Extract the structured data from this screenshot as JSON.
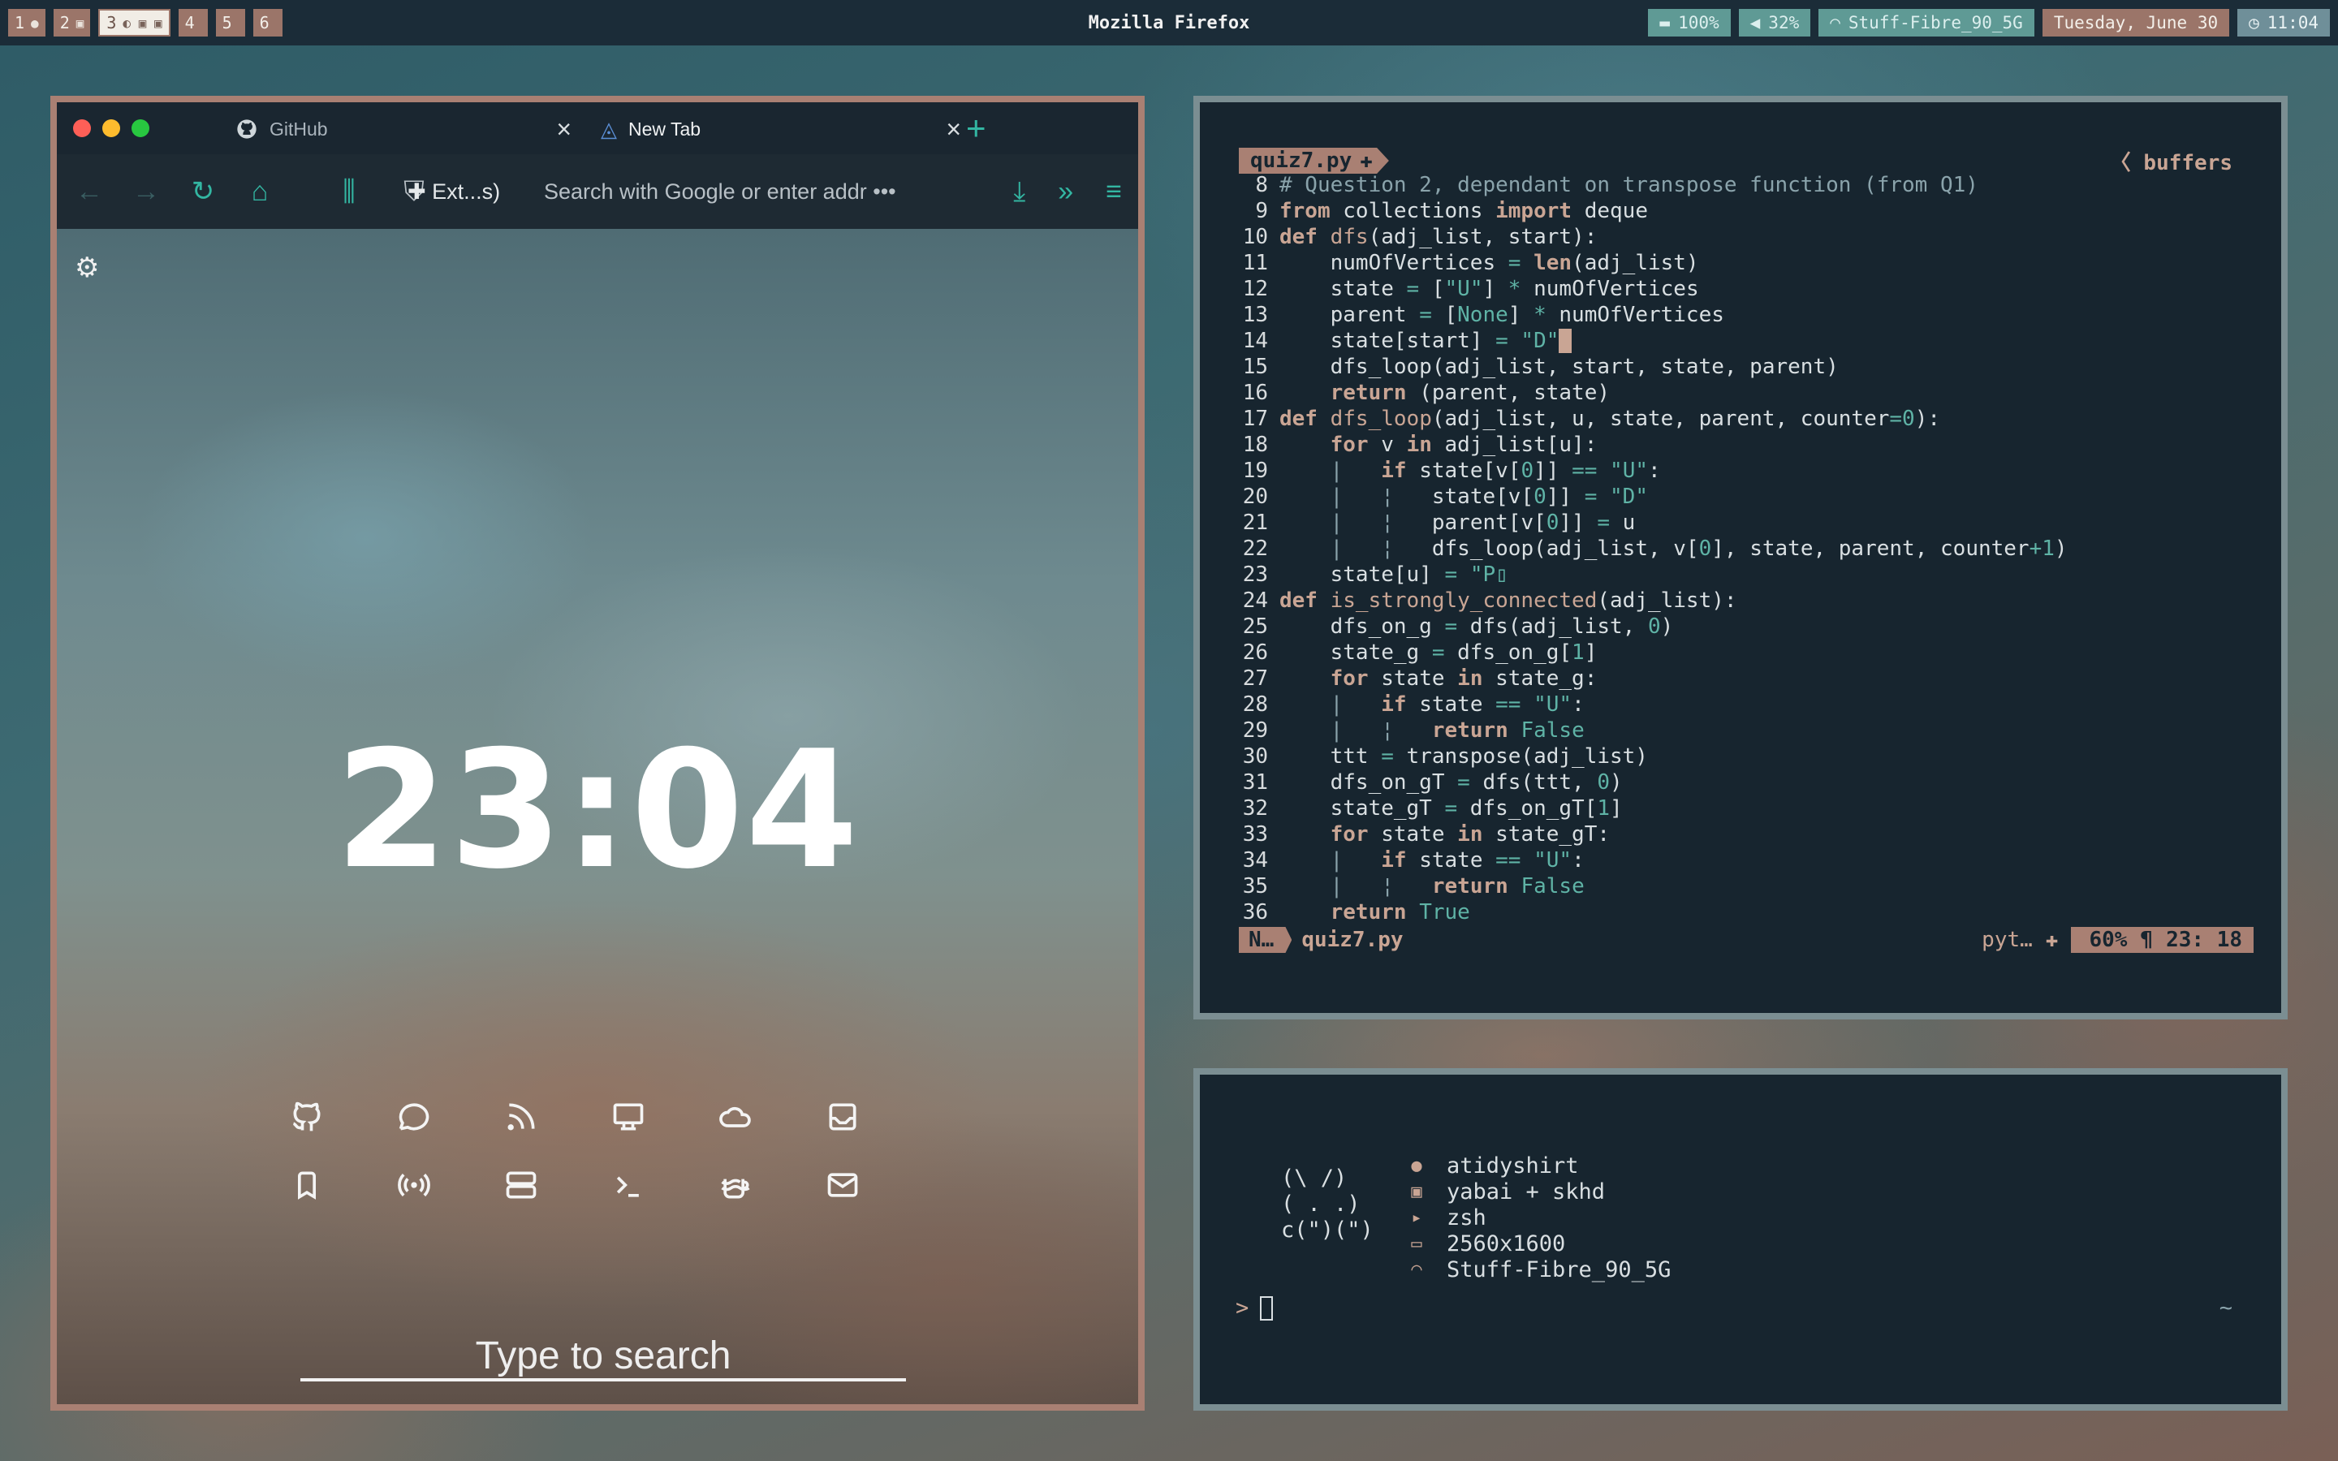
{
  "topbar": {
    "workspaces": [
      {
        "label": "1",
        "icon": "●"
      },
      {
        "label": "2",
        "icon": "▣"
      },
      {
        "label": "3",
        "icon": "◐ ▣ ▣"
      },
      {
        "label": "4",
        "icon": ""
      },
      {
        "label": "5",
        "icon": ""
      },
      {
        "label": "6",
        "icon": ""
      }
    ],
    "title": "Mozilla Firefox",
    "battery": "100%",
    "volume": "32%",
    "wifi": "Stuff-Fibre_90_5G",
    "date": "Tuesday, June 30",
    "time": "11:04"
  },
  "browser": {
    "tabs": [
      {
        "label": "GitHub",
        "icon": "github-icon"
      },
      {
        "label": "New Tab",
        "icon": "firefox-icon"
      }
    ],
    "extensions_label": "Ext...s)",
    "url_placeholder": "Search with Google or enter addr",
    "more_glyph": "•••",
    "clock": "23:04",
    "search_placeholder": "Type to search",
    "shortcuts": [
      "github",
      "chat",
      "rss",
      "monitor",
      "cloud",
      "inbox",
      "bookmark",
      "broadcast",
      "server",
      "terminal",
      "coffee",
      "mail"
    ]
  },
  "editor": {
    "filename": "quiz7.py",
    "buffers_label": "buffers",
    "lines": [
      {
        "n": "8",
        "html": "<span class='cm'># Question 2, dependant on transpose function (from Q1)</span>"
      },
      {
        "n": "9",
        "html": "<span class='kw'>from</span> collections <span class='kw'>import</span> deque"
      },
      {
        "n": "10",
        "html": "<span class='kw'>def</span> <span class='fn'>dfs</span>(adj_list, start):"
      },
      {
        "n": "11",
        "html": "    numOfVertices <span class='op'>=</span> <span class='kw'>len</span>(adj_list)"
      },
      {
        "n": "12",
        "html": "    state <span class='op'>=</span> [<span class='str'>\"U\"</span>] <span class='op'>*</span> numOfVertices"
      },
      {
        "n": "13",
        "html": "    parent <span class='op'>=</span> [<span class='nb'>None</span>] <span class='op'>*</span> numOfVertices"
      },
      {
        "n": "14",
        "html": "    state[start] <span class='op'>=</span> <span class='str'>\"D\"</span><span class='cursor'> </span>"
      },
      {
        "n": "15",
        "html": "    dfs_loop(adj_list, start, state, parent)"
      },
      {
        "n": "16",
        "html": "    <span class='kw'>return</span> (parent, state)"
      },
      {
        "n": "17",
        "html": "<span class='kw'>def</span> <span class='fn'>dfs_loop</span>(adj_list, u, state, parent, counter<span class='op'>=</span><span class='nb'>0</span>):"
      },
      {
        "n": "18",
        "html": "    <span class='kw'>for</span> v <span class='kw'>in</span> adj_list[u]:"
      },
      {
        "n": "19",
        "html": "    <span class='cm'>|</span>   <span class='kw'>if</span> state[v[<span class='nb'>0</span>]] <span class='op'>==</span> <span class='str'>\"U\"</span>:"
      },
      {
        "n": "20",
        "html": "    <span class='cm'>|</span>   <span class='cm'>¦</span>   state[v[<span class='nb'>0</span>]] <span class='op'>=</span> <span class='str'>\"D\"</span>"
      },
      {
        "n": "21",
        "html": "    <span class='cm'>|</span>   <span class='cm'>¦</span>   parent[v[<span class='nb'>0</span>]] <span class='op'>=</span> u"
      },
      {
        "n": "22",
        "html": "    <span class='cm'>|</span>   <span class='cm'>¦</span>   dfs_loop(adj_list, v[<span class='nb'>0</span>], state, parent, counter<span class='op'>+</span><span class='nb'>1</span>)"
      },
      {
        "n": "23",
        "html": "    state[u] <span class='op'>=</span> <span class='str'>\"P</span><span class='str'>▯</span>"
      },
      {
        "n": "24",
        "html": "<span class='kw'>def</span> <span class='fn'>is_strongly_connected</span>(adj_list):"
      },
      {
        "n": "25",
        "html": "    dfs_on_g <span class='op'>=</span> dfs(adj_list, <span class='nb'>0</span>)"
      },
      {
        "n": "26",
        "html": "    state_g <span class='op'>=</span> dfs_on_g[<span class='nb'>1</span>]"
      },
      {
        "n": "27",
        "html": "    <span class='kw'>for</span> state <span class='kw'>in</span> state_g:"
      },
      {
        "n": "28",
        "html": "    <span class='cm'>|</span>   <span class='kw'>if</span> state <span class='op'>==</span> <span class='str'>\"U\"</span>:"
      },
      {
        "n": "29",
        "html": "    <span class='cm'>|</span>   <span class='cm'>¦</span>   <span class='kw'>return</span> <span class='nb'>False</span>"
      },
      {
        "n": "30",
        "html": "    ttt <span class='op'>=</span> transpose(adj_list)"
      },
      {
        "n": "31",
        "html": "    dfs_on_gT <span class='op'>=</span> dfs(ttt, <span class='nb'>0</span>)"
      },
      {
        "n": "32",
        "html": "    state_gT <span class='op'>=</span> dfs_on_gT[<span class='nb'>1</span>]"
      },
      {
        "n": "33",
        "html": "    <span class='kw'>for</span> state <span class='kw'>in</span> state_gT:"
      },
      {
        "n": "34",
        "html": "    <span class='cm'>|</span>   <span class='kw'>if</span> state <span class='op'>==</span> <span class='str'>\"U\"</span>:"
      },
      {
        "n": "35",
        "html": "    <span class='cm'>|</span>   <span class='cm'>¦</span>   <span class='kw'>return</span> <span class='nb'>False</span>"
      },
      {
        "n": "36",
        "html": "    <span class='kw'>return</span> <span class='nb'>True</span>"
      }
    ],
    "status": {
      "mode": "N…",
      "file": "quiz7.py",
      "filetype": "pyt…",
      "percent": "60%",
      "pilcrow": "¶",
      "position": "23: 18"
    }
  },
  "terminal": {
    "ascii": [
      "(\\ /)",
      "( . .)",
      "c(\")(\")"
    ],
    "info": [
      {
        "icon": "apple-icon",
        "glyph": "●",
        "text": "atidyshirt"
      },
      {
        "icon": "window-manager-icon",
        "glyph": "▣",
        "text": "yabai + skhd"
      },
      {
        "icon": "shell-icon",
        "glyph": "▸",
        "text": "zsh"
      },
      {
        "icon": "monitor-icon",
        "glyph": "▭",
        "text": "2560x1600"
      },
      {
        "icon": "wifi-icon",
        "glyph": "◠",
        "text": "Stuff-Fibre_90_5G"
      }
    ],
    "prompt": ">",
    "cwd": "~"
  },
  "colors": {
    "accent_teal": "#33b6a2",
    "accent_brown": "#a98073",
    "panel_bg": "#17252f"
  }
}
